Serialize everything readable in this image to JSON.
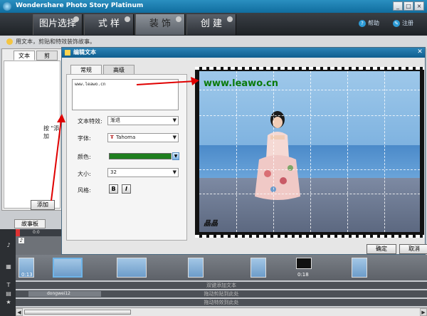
{
  "window": {
    "title": "Wondershare Photo Story Platinum"
  },
  "nav": {
    "tabs": [
      {
        "label": "图片选择"
      },
      {
        "label": "式 样"
      },
      {
        "label": "装 饰",
        "active": true
      },
      {
        "label": "创 建"
      }
    ],
    "help": "帮助",
    "register": "注册"
  },
  "hint": "用文本，剪贴和特效装饰故事。",
  "left_panel": {
    "tabs": [
      "文本",
      "剪"
    ],
    "body_text": "按 \"添加",
    "add_button": "添加"
  },
  "dialog": {
    "title": "编辑文本",
    "tabs": [
      "常规",
      "高级"
    ],
    "text_value": "www.leawo.cn",
    "fields": {
      "effect_label": "文本特效:",
      "effect_value": "渐退",
      "font_label": "字体:",
      "font_value": "Tahoma",
      "color_label": "颜色:",
      "size_label": "大小:",
      "size_value": "32",
      "style_label": "风格:",
      "bold": "B",
      "italic": "I"
    },
    "color_value": "#1f7f1f",
    "ok": "确定",
    "cancel": "取消"
  },
  "preview": {
    "watermark": "www.leawo.cn",
    "logo": "晶晶"
  },
  "storyboard": {
    "tab": "故事板",
    "ruler_label": "0:0",
    "thumb_labels": [
      "0:13",
      "0:18"
    ],
    "tracks": {
      "text_track": "双键添加文本",
      "clip_track": "拖动剪贴到此处",
      "clip_name": "dongwei12",
      "effect_track": "拖动特效到此处"
    }
  }
}
